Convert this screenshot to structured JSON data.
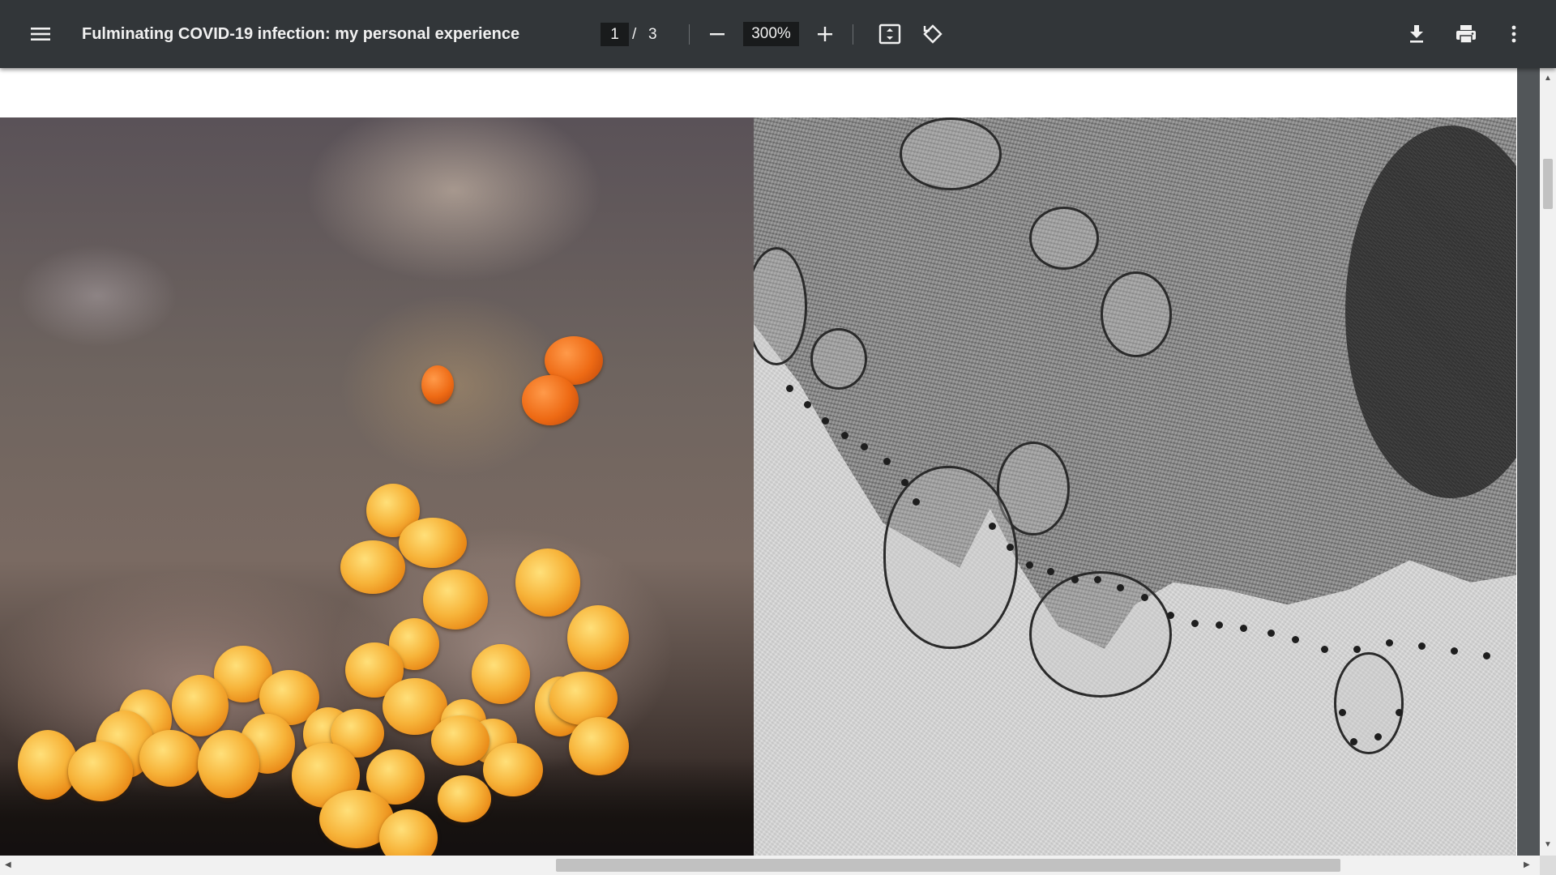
{
  "toolbar": {
    "menu_icon": "hamburger-menu-icon",
    "title": "Fulminating COVID-19 infection: my personal experience",
    "page_current": "1",
    "page_separator": "/",
    "page_total": "3",
    "zoom_out_icon": "minus-icon",
    "zoom_value": "300%",
    "zoom_in_icon": "plus-icon",
    "fit_icon": "fit-to-page-icon",
    "rotate_icon": "rotate-counterclockwise-icon",
    "download_icon": "download-icon",
    "print_icon": "print-icon",
    "more_icon": "more-vertical-icon"
  },
  "colors": {
    "toolbar_bg": "#323639",
    "toolbar_text": "#f1f1f1",
    "input_bg": "#191b1c",
    "viewport_bg": "#525659",
    "page_bg": "#ffffff",
    "scrollbar_track": "#f1f1f1",
    "scrollbar_thumb": "#c1c1c1"
  },
  "document": {
    "figure_left": "sem-micrograph-orange-virus-particles",
    "figure_right": "tem-micrograph-grayscale-cell-section"
  }
}
